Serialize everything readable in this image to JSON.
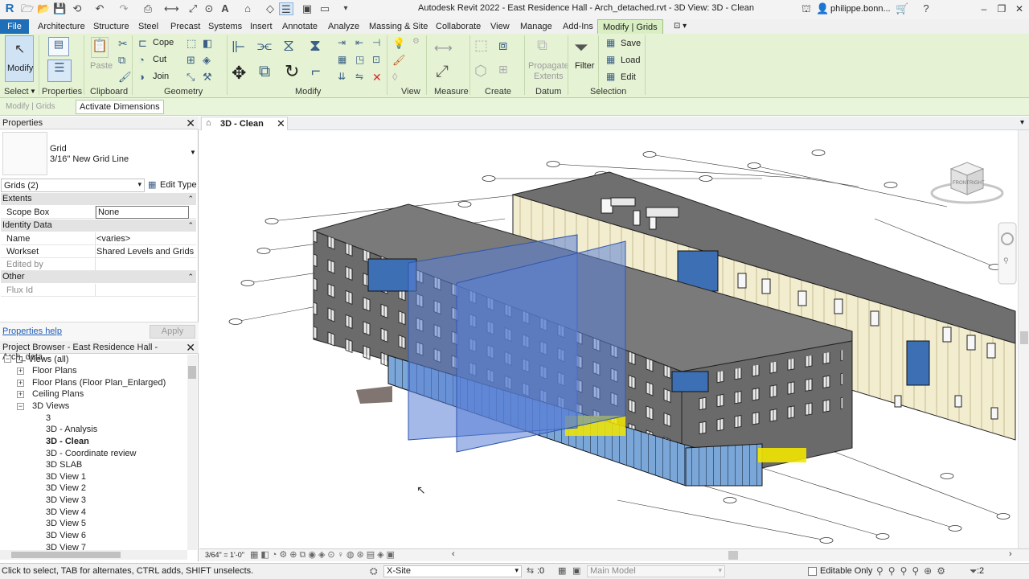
{
  "titlebar": {
    "title": "Autodesk Revit 2022 - East Residence Hall - Arch_detached.rvt - 3D View: 3D - Clean",
    "user": "philippe.bonn...",
    "qa_icons": [
      "open-icon",
      "save-icon",
      "sync-icon",
      "undo-icon",
      "redo-icon",
      "print-icon",
      "measure-icon",
      "dimension-icon",
      "tag-icon",
      "text-icon",
      "3d-view-icon",
      "section-icon",
      "close-hidden-icon",
      "switch-windows-icon"
    ]
  },
  "tabs": [
    "File",
    "Architecture",
    "Structure",
    "Steel",
    "Precast",
    "Systems",
    "Insert",
    "Annotate",
    "Analyze",
    "Massing & Site",
    "Collaborate",
    "View",
    "Manage",
    "Add-Ins",
    "Modify | Grids"
  ],
  "ribbon": {
    "modify_label": "Modify",
    "cope": "Cope",
    "cut": "Cut",
    "join": "Join",
    "paste": "Paste",
    "propagate": [
      "Propagate",
      "Extents"
    ],
    "filter": "Filter",
    "save": "Save",
    "load": "Load",
    "edit": "Edit",
    "panels": [
      "Select",
      "Properties",
      "Clipboard",
      "Geometry",
      "Modify",
      "View",
      "Measure",
      "Create",
      "Datum",
      "Selection"
    ]
  },
  "optionsbar": {
    "context": "Modify | Grids",
    "button": "Activate Dimensions"
  },
  "properties": {
    "title": "Properties",
    "type_name": "Grid",
    "type_sub": "3/16\" New Grid Line",
    "selector": "Grids (2)",
    "edit_type": "Edit Type",
    "groups": {
      "extents": "Extents",
      "identity": "Identity Data",
      "other": "Other"
    },
    "rows": {
      "scope_box_k": "Scope Box",
      "scope_box_v": "None",
      "name_k": "Name",
      "name_v": "<varies>",
      "workset_k": "Workset",
      "workset_v": "Shared Levels and Grids",
      "edited_k": "Edited by",
      "edited_v": "",
      "flux_k": "Flux Id",
      "flux_v": ""
    },
    "help": "Properties help",
    "apply": "Apply"
  },
  "browser": {
    "title": "Project Browser - East Residence Hall - Arch_deta...",
    "root": "Views (all)",
    "groups": [
      "Floor Plans",
      "Floor Plans (Floor Plan_Enlarged)",
      "Ceiling Plans",
      "3D Views"
    ],
    "views": [
      "3",
      "3D - Analysis",
      "3D - Clean",
      "3D - Coordinate review",
      "3D SLAB",
      "3D View 1",
      "3D View 2",
      "3D View 3",
      "3D View 4",
      "3D View 5",
      "3D View 6",
      "3D View 7"
    ],
    "active_view": "3D - Clean"
  },
  "view": {
    "tab": "3D - Clean",
    "scale": "3/64\" = 1'-0\"",
    "viewcube": {
      "front": "FRONT",
      "right": "RIGHT"
    }
  },
  "status": {
    "hint": "Click to select, TAB for alternates, CTRL adds, SHIFT unselects.",
    "workset": "X-Site",
    "zero": ":0",
    "model": "Main Model",
    "editable": "Editable Only",
    "filter_count": ":2"
  },
  "colors": {
    "ribbon_bg": "#e5f3d4",
    "file_tab": "#1f6fb8",
    "building_dark": "#6b6b6b",
    "facade_cream": "#f3edcf",
    "glass_blue": "#4d86c9",
    "grid_plane": "#5a7fd6",
    "accent_yellow": "#f2e600"
  }
}
